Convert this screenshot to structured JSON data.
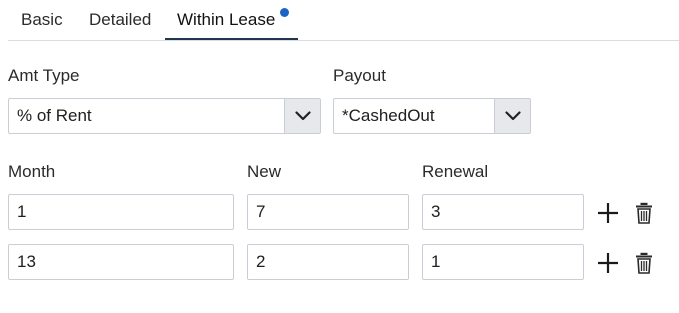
{
  "tabs": [
    {
      "label": "Basic"
    },
    {
      "label": "Detailed"
    },
    {
      "label": "Within Lease"
    }
  ],
  "active_tab": "Within Lease",
  "amt_type": {
    "label": "Amt Type",
    "value": "% of Rent"
  },
  "payout": {
    "label": "Payout",
    "value": "*CashedOut"
  },
  "grid": {
    "headers": {
      "month": "Month",
      "new": "New",
      "renewal": "Renewal"
    },
    "rows": [
      {
        "month": "1",
        "new": "7",
        "renewal": "3"
      },
      {
        "month": "13",
        "new": "2",
        "renewal": "1"
      }
    ]
  },
  "icons": {
    "add": "plus-icon",
    "delete": "trash-icon",
    "dropdown": "chevron-down-icon",
    "unsaved_indicator": "dot-indicator"
  },
  "colors": {
    "active_tab_underline": "#1f3550",
    "indicator_dot": "#1c63c6",
    "border": "#c9ced6",
    "select_arrow_bg": "#e6e8eb"
  }
}
